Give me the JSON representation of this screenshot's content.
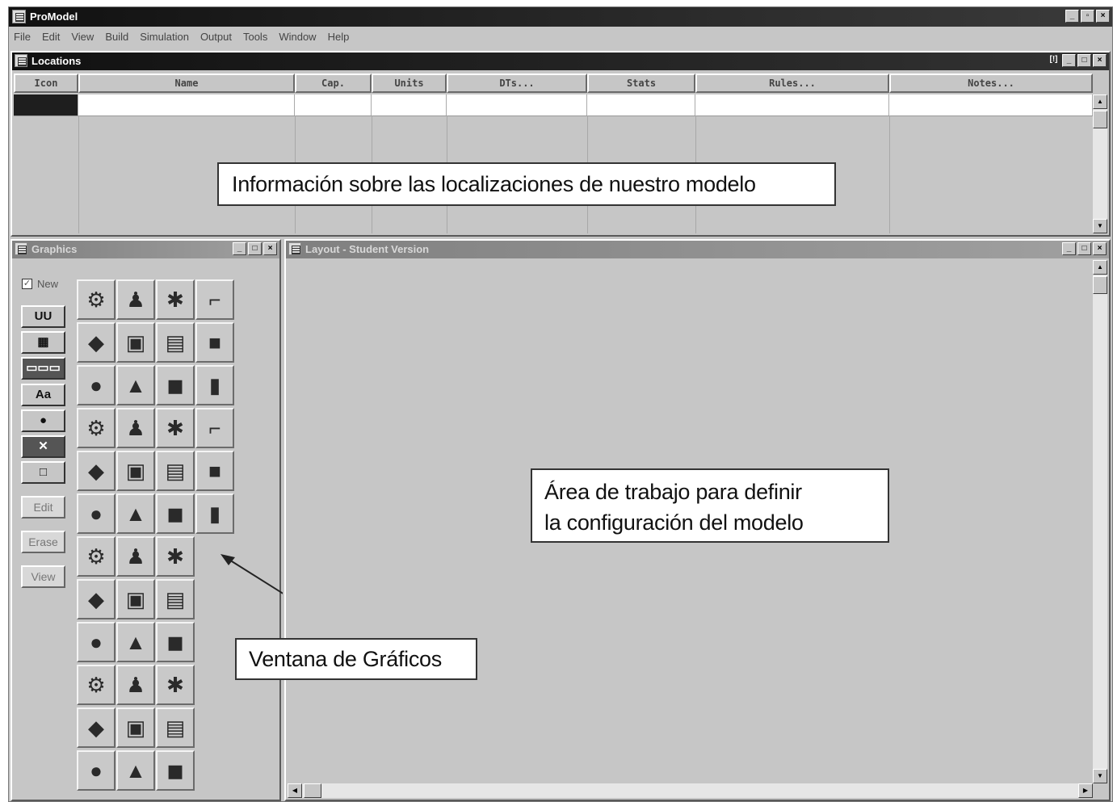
{
  "app": {
    "title": "ProModel",
    "window_buttons": [
      "_",
      "□",
      "×"
    ]
  },
  "menu": [
    "File",
    "Edit",
    "View",
    "Build",
    "Simulation",
    "Output",
    "Tools",
    "Window",
    "Help"
  ],
  "locations_window": {
    "title": "Locations",
    "columns": [
      "Icon",
      "Name",
      "Cap.",
      "Units",
      "DTs...",
      "Stats",
      "Rules...",
      "Notes..."
    ]
  },
  "graphics_window": {
    "title": "Graphics",
    "new_checkbox": {
      "label": "New",
      "checked": true
    },
    "tool_buttons": [
      "UU",
      "▦",
      "▭▭▭",
      "Aa",
      "●",
      "✕",
      "□"
    ],
    "action_buttons": [
      "Edit",
      "Erase",
      "View"
    ],
    "icons": [
      [
        "machine-icon",
        "person-icon",
        "gears-icon",
        "robot-arm-icon"
      ],
      [
        "lathe-icon",
        "worker-icon",
        "engine-icon",
        "crates-icon"
      ],
      [
        "pallet-icon",
        "stack-icon",
        "operator-icon",
        "rack-icon"
      ],
      [
        "walker-icon",
        "forklift-icon",
        "conveyor-disc-icon",
        "circle-icon"
      ],
      [
        "box-icon",
        "bar-icon",
        "printer-icon",
        "figure-icon"
      ],
      [
        "tray-icon",
        "tube-icon",
        "cart-icon",
        "vehicle-icon"
      ],
      [
        "mat-icon",
        "chair-icon",
        "motor-icon"
      ],
      [
        "rod-icon",
        "truck-icon",
        "drill-icon"
      ],
      [
        "barrel-icon",
        "press-icon",
        "station-icon"
      ],
      [
        "car-icon",
        "arrow-icon",
        "belt-icon"
      ],
      [
        "crane-icon",
        "plane-icon",
        "bin-icon"
      ],
      [
        "gun-icon",
        "wire-icon",
        "loader-icon"
      ]
    ]
  },
  "layout_window": {
    "title": "Layout - Student Version"
  },
  "annotations": {
    "locations_info": "Información sobre las localizaciones de nuestro modelo",
    "workspace_line1": "Área de trabajo para definir",
    "workspace_line2": "la configuración del modelo",
    "graphics_label": "Ventana de Gráficos"
  }
}
